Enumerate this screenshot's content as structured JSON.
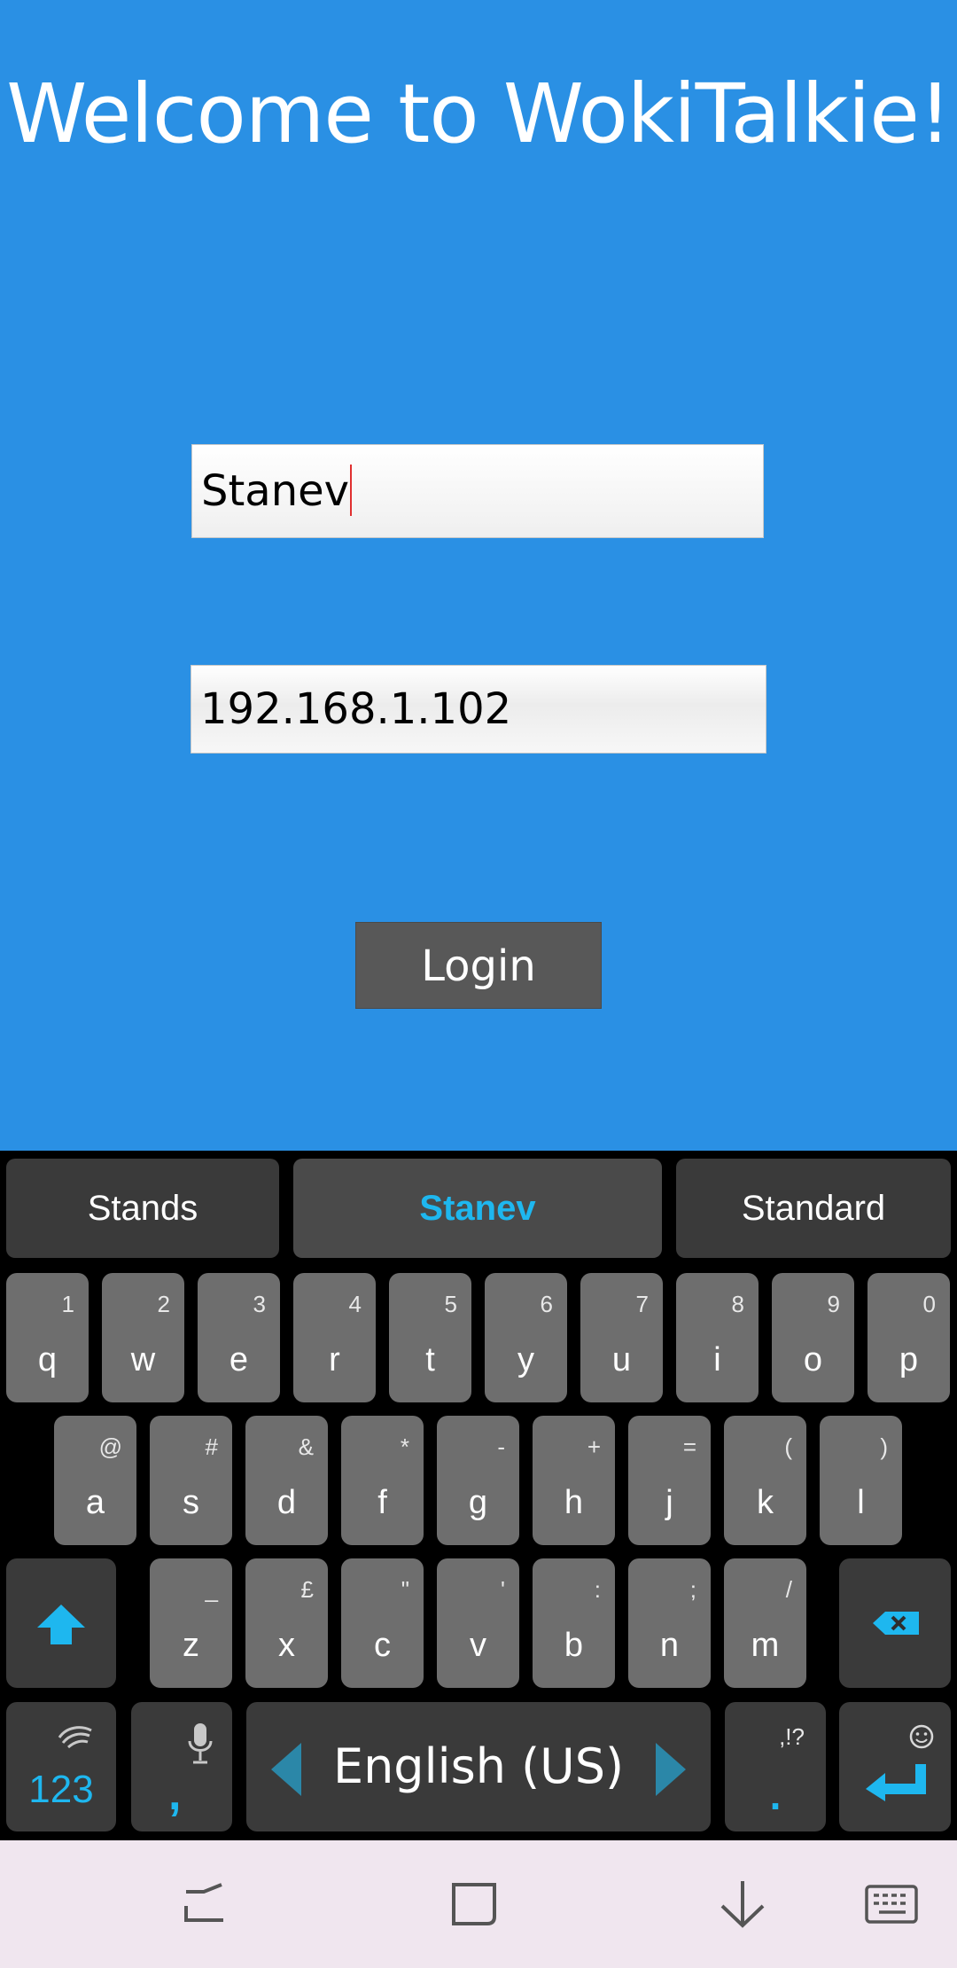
{
  "app": {
    "title": "Welcome to WokiTalkie!",
    "username_value": "Stanev",
    "ip_value": "192.168.1.102",
    "login_label": "Login",
    "colors": {
      "background": "#2a90e4",
      "button": "#585858",
      "accent": "#1eb7ef"
    }
  },
  "keyboard": {
    "suggestions": [
      "Stands",
      "Stanev",
      "Standard"
    ],
    "row1": [
      {
        "k": "q",
        "s": "1"
      },
      {
        "k": "w",
        "s": "2"
      },
      {
        "k": "e",
        "s": "3"
      },
      {
        "k": "r",
        "s": "4"
      },
      {
        "k": "t",
        "s": "5"
      },
      {
        "k": "y",
        "s": "6"
      },
      {
        "k": "u",
        "s": "7"
      },
      {
        "k": "i",
        "s": "8"
      },
      {
        "k": "o",
        "s": "9"
      },
      {
        "k": "p",
        "s": "0"
      }
    ],
    "row2": [
      {
        "k": "a",
        "s": "@"
      },
      {
        "k": "s",
        "s": "#"
      },
      {
        "k": "d",
        "s": "&"
      },
      {
        "k": "f",
        "s": "*"
      },
      {
        "k": "g",
        "s": "-"
      },
      {
        "k": "h",
        "s": "+"
      },
      {
        "k": "j",
        "s": "="
      },
      {
        "k": "k",
        "s": "("
      },
      {
        "k": "l",
        "s": ")"
      }
    ],
    "row3": [
      {
        "k": "z",
        "s": "_"
      },
      {
        "k": "x",
        "s": "£"
      },
      {
        "k": "c",
        "s": "\""
      },
      {
        "k": "v",
        "s": "'"
      },
      {
        "k": "b",
        "s": ":"
      },
      {
        "k": "n",
        "s": ";"
      },
      {
        "k": "m",
        "s": "/"
      }
    ],
    "symbols_label": "123",
    "comma_label": ",",
    "space_label": "English (US)",
    "period_label": ".",
    "period_sec": ",!?",
    "icons": [
      "shift-icon",
      "backspace-icon",
      "swiftkey-logo-icon",
      "microphone-icon",
      "emoji-icon",
      "enter-icon"
    ]
  },
  "navbar": {
    "icons": [
      "recent-apps-icon",
      "home-icon",
      "back-icon",
      "keyboard-switch-icon"
    ]
  }
}
